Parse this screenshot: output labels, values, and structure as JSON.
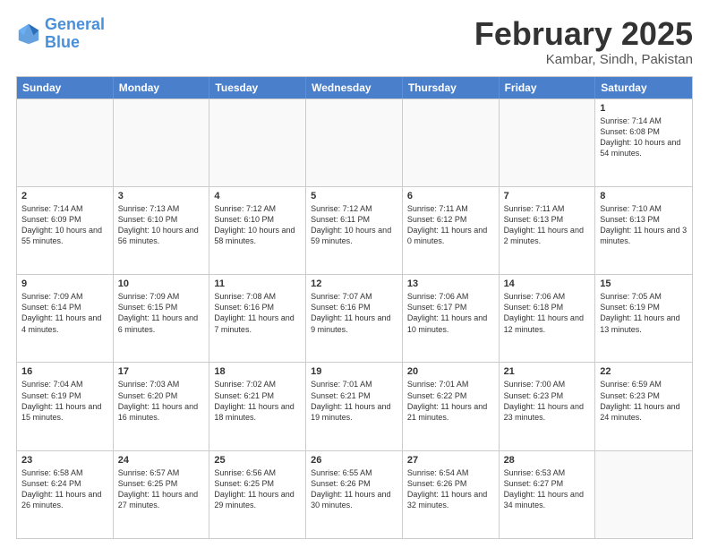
{
  "header": {
    "logo_line1": "General",
    "logo_line2": "Blue",
    "month": "February 2025",
    "location": "Kambar, Sindh, Pakistan"
  },
  "weekdays": [
    "Sunday",
    "Monday",
    "Tuesday",
    "Wednesday",
    "Thursday",
    "Friday",
    "Saturday"
  ],
  "rows": [
    [
      {
        "day": "",
        "empty": true
      },
      {
        "day": "",
        "empty": true
      },
      {
        "day": "",
        "empty": true
      },
      {
        "day": "",
        "empty": true
      },
      {
        "day": "",
        "empty": true
      },
      {
        "day": "",
        "empty": true
      },
      {
        "day": "1",
        "sunrise": "7:14 AM",
        "sunset": "6:08 PM",
        "daylight": "10 hours and 54 minutes."
      }
    ],
    [
      {
        "day": "2",
        "sunrise": "7:14 AM",
        "sunset": "6:09 PM",
        "daylight": "10 hours and 55 minutes."
      },
      {
        "day": "3",
        "sunrise": "7:13 AM",
        "sunset": "6:10 PM",
        "daylight": "10 hours and 56 minutes."
      },
      {
        "day": "4",
        "sunrise": "7:12 AM",
        "sunset": "6:10 PM",
        "daylight": "10 hours and 58 minutes."
      },
      {
        "day": "5",
        "sunrise": "7:12 AM",
        "sunset": "6:11 PM",
        "daylight": "10 hours and 59 minutes."
      },
      {
        "day": "6",
        "sunrise": "7:11 AM",
        "sunset": "6:12 PM",
        "daylight": "11 hours and 0 minutes."
      },
      {
        "day": "7",
        "sunrise": "7:11 AM",
        "sunset": "6:13 PM",
        "daylight": "11 hours and 2 minutes."
      },
      {
        "day": "8",
        "sunrise": "7:10 AM",
        "sunset": "6:13 PM",
        "daylight": "11 hours and 3 minutes."
      }
    ],
    [
      {
        "day": "9",
        "sunrise": "7:09 AM",
        "sunset": "6:14 PM",
        "daylight": "11 hours and 4 minutes."
      },
      {
        "day": "10",
        "sunrise": "7:09 AM",
        "sunset": "6:15 PM",
        "daylight": "11 hours and 6 minutes."
      },
      {
        "day": "11",
        "sunrise": "7:08 AM",
        "sunset": "6:16 PM",
        "daylight": "11 hours and 7 minutes."
      },
      {
        "day": "12",
        "sunrise": "7:07 AM",
        "sunset": "6:16 PM",
        "daylight": "11 hours and 9 minutes."
      },
      {
        "day": "13",
        "sunrise": "7:06 AM",
        "sunset": "6:17 PM",
        "daylight": "11 hours and 10 minutes."
      },
      {
        "day": "14",
        "sunrise": "7:06 AM",
        "sunset": "6:18 PM",
        "daylight": "11 hours and 12 minutes."
      },
      {
        "day": "15",
        "sunrise": "7:05 AM",
        "sunset": "6:19 PM",
        "daylight": "11 hours and 13 minutes."
      }
    ],
    [
      {
        "day": "16",
        "sunrise": "7:04 AM",
        "sunset": "6:19 PM",
        "daylight": "11 hours and 15 minutes."
      },
      {
        "day": "17",
        "sunrise": "7:03 AM",
        "sunset": "6:20 PM",
        "daylight": "11 hours and 16 minutes."
      },
      {
        "day": "18",
        "sunrise": "7:02 AM",
        "sunset": "6:21 PM",
        "daylight": "11 hours and 18 minutes."
      },
      {
        "day": "19",
        "sunrise": "7:01 AM",
        "sunset": "6:21 PM",
        "daylight": "11 hours and 19 minutes."
      },
      {
        "day": "20",
        "sunrise": "7:01 AM",
        "sunset": "6:22 PM",
        "daylight": "11 hours and 21 minutes."
      },
      {
        "day": "21",
        "sunrise": "7:00 AM",
        "sunset": "6:23 PM",
        "daylight": "11 hours and 23 minutes."
      },
      {
        "day": "22",
        "sunrise": "6:59 AM",
        "sunset": "6:23 PM",
        "daylight": "11 hours and 24 minutes."
      }
    ],
    [
      {
        "day": "23",
        "sunrise": "6:58 AM",
        "sunset": "6:24 PM",
        "daylight": "11 hours and 26 minutes."
      },
      {
        "day": "24",
        "sunrise": "6:57 AM",
        "sunset": "6:25 PM",
        "daylight": "11 hours and 27 minutes."
      },
      {
        "day": "25",
        "sunrise": "6:56 AM",
        "sunset": "6:25 PM",
        "daylight": "11 hours and 29 minutes."
      },
      {
        "day": "26",
        "sunrise": "6:55 AM",
        "sunset": "6:26 PM",
        "daylight": "11 hours and 30 minutes."
      },
      {
        "day": "27",
        "sunrise": "6:54 AM",
        "sunset": "6:26 PM",
        "daylight": "11 hours and 32 minutes."
      },
      {
        "day": "28",
        "sunrise": "6:53 AM",
        "sunset": "6:27 PM",
        "daylight": "11 hours and 34 minutes."
      },
      {
        "day": "",
        "empty": true
      }
    ]
  ]
}
